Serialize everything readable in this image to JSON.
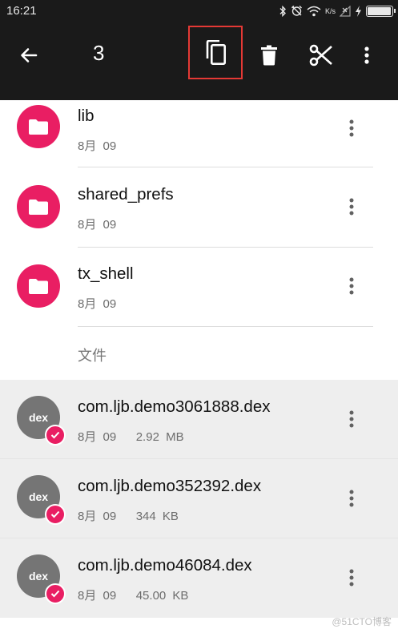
{
  "status_bar": {
    "time": "16:21",
    "network_speed": "K/s",
    "icons": [
      "bluetooth-icon",
      "alarm-off-icon",
      "wifi-icon",
      "signal-icon",
      "charging-icon",
      "battery-icon"
    ],
    "battery_level": 0.95
  },
  "toolbar": {
    "selected_count": "3",
    "actions": [
      "back-arrow-icon",
      "copy-icon",
      "delete-icon",
      "cut-icon",
      "more-vert-icon"
    ],
    "highlight_color": "#e53935"
  },
  "folders": [
    {
      "name": "lib",
      "date": "8月 09"
    },
    {
      "name": "shared_prefs",
      "date": "8月 09"
    },
    {
      "name": "tx_shell",
      "date": "8月 09"
    }
  ],
  "section_files": "文件",
  "files": [
    {
      "icon_label": "dex",
      "name": "com.ljb.demo3061888.dex",
      "date": "8月 09",
      "size": "2.92 MB",
      "selected": true
    },
    {
      "icon_label": "dex",
      "name": "com.ljb.demo352392.dex",
      "date": "8月 09",
      "size": "344 KB",
      "selected": true
    },
    {
      "icon_label": "dex",
      "name": "com.ljb.demo46084.dex",
      "date": "8月 09",
      "size": "45.00 KB",
      "selected": true
    }
  ],
  "watermark": "@51CTO博客",
  "colors": {
    "accent": "#e91e63",
    "toolbar": "#1a1a1a",
    "selected_row": "#eeeeee",
    "dex_icon": "#757575"
  }
}
